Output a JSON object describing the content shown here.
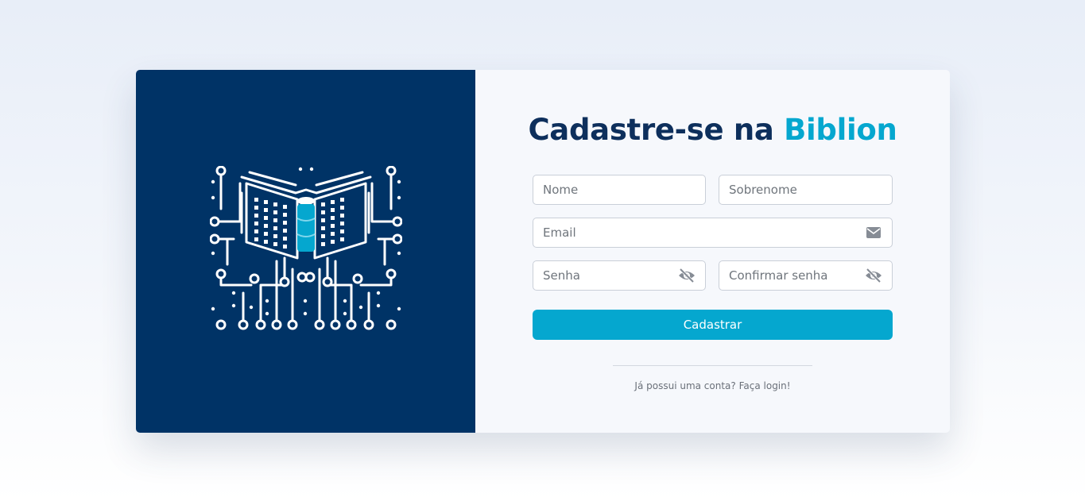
{
  "logo": {
    "name": "biblion-circuit-book-logo"
  },
  "form": {
    "title_prefix": "Cadastre-se na ",
    "title_brand": "Biblion",
    "fields": {
      "nome": {
        "placeholder": "Nome",
        "value": ""
      },
      "sobrenome": {
        "placeholder": "Sobrenome",
        "value": ""
      },
      "email": {
        "placeholder": "Email",
        "value": "",
        "icon": "envelope-icon"
      },
      "senha": {
        "placeholder": "Senha",
        "value": "",
        "icon": "eye-slash-icon"
      },
      "confirmar": {
        "placeholder": "Confirmar senha",
        "value": "",
        "icon": "eye-slash-icon"
      }
    },
    "submit_label": "Cadastrar",
    "login_prompt": "Já possui uma conta? Faça login!"
  },
  "colors": {
    "panel": "#003366",
    "accent": "#05a7cf",
    "title": "#0d2f5c",
    "icon": "#868c95"
  }
}
